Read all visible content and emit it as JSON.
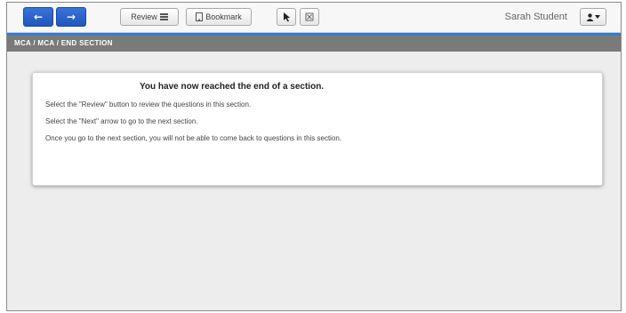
{
  "toolbar": {
    "back_icon": "arrow-left-icon",
    "next_icon": "arrow-right-icon",
    "review_label": "Review",
    "bookmark_label": "Bookmark",
    "pointer_icon": "pointer-icon",
    "eliminate_icon": "answer-eliminator-icon",
    "user_name": "Sarah Student",
    "user_menu_icon": "user-icon"
  },
  "breadcrumb": {
    "text": "MCA / MCA / END SECTION"
  },
  "card": {
    "title": "You have now reached the end of a section.",
    "lines": [
      "Select the \"Review\" button to review the questions in this section.",
      "Select the \"Next\" arrow to go to the next section.",
      "Once you go to the next section, you will not be able to come back to questions in this section."
    ]
  },
  "colors": {
    "nav_button": "#2a63cc",
    "accent_line": "#2f7fd1",
    "breadcrumb_bar": "#7a7a7a",
    "background": "#ededed"
  }
}
